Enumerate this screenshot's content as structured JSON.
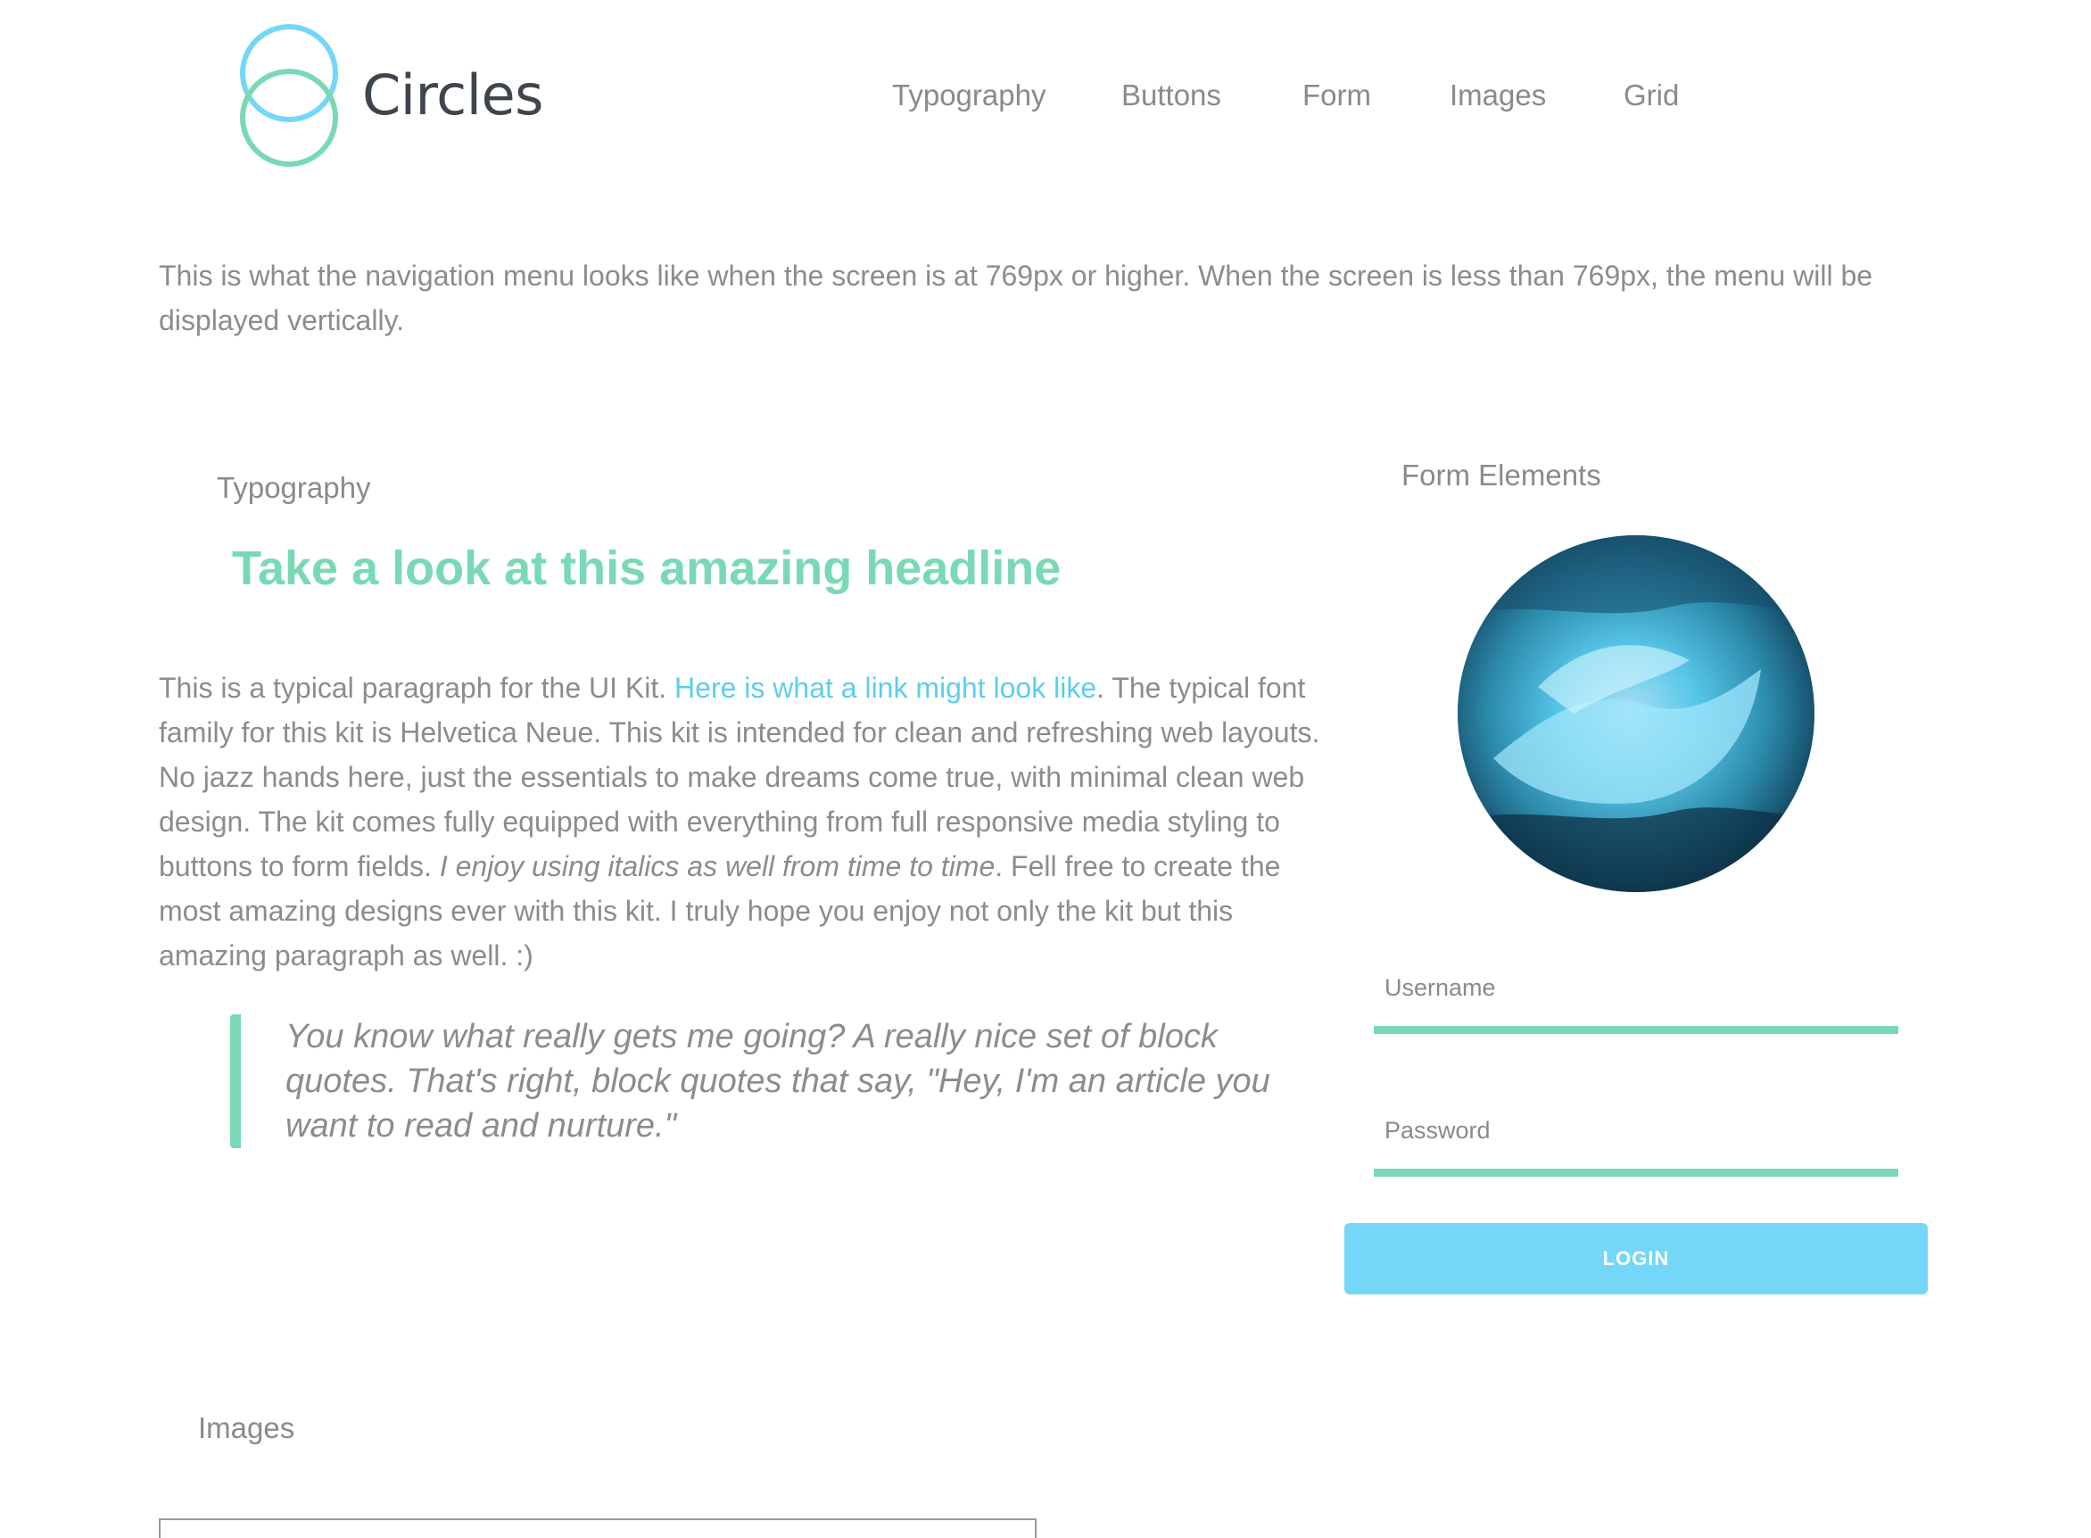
{
  "header": {
    "brand_name": "Circles",
    "logo_icon": "circles-logo-icon",
    "nav_items": [
      "Typography",
      "Buttons",
      "Form",
      "Images",
      "Grid"
    ]
  },
  "nav_note": "This is what the navigation menu looks like when the screen is at 769px or higher. When the screen is less than 769px, the menu will be displayed vertically.",
  "typography": {
    "section_label": "Typography",
    "headline": "Take a look at this amazing headline",
    "paragraph": {
      "text_before_link": "This is a typical paragraph for the UI Kit. ",
      "link_text": "Here is what a link might look like",
      "text_after_link": ". The typical font family for this kit is Helvetica Neue. This kit is intended for clean and refreshing web layouts. No jazz hands here, just the essentials to make dreams come true, with minimal clean web design. The kit comes fully equipped with everything from full responsive media styling to buttons to form fields. ",
      "italic_text": "I enjoy using italics as well from time to time",
      "text_end": ". Fell free to create the most amazing designs ever with this kit. I truly hope you enjoy not only the kit but this amazing paragraph as well. :)"
    },
    "blockquote": "You know what really gets me going? A really nice set of block quotes. That's right, block quotes that say, \"Hey, I'm an article you want to read and nurture.\""
  },
  "form": {
    "section_label": "Form Elements",
    "avatar_image": "ocean-wave-image",
    "username_placeholder": "Username",
    "password_placeholder": "Password",
    "login_label": "LOGIN"
  },
  "images": {
    "section_label": "Images"
  },
  "colors": {
    "accent_green": "#7ad9b5",
    "accent_blue": "#74d7f7",
    "link_blue": "#5ccdf0",
    "text_gray": "#8c8c8c",
    "brand_dark": "#3e454c"
  }
}
